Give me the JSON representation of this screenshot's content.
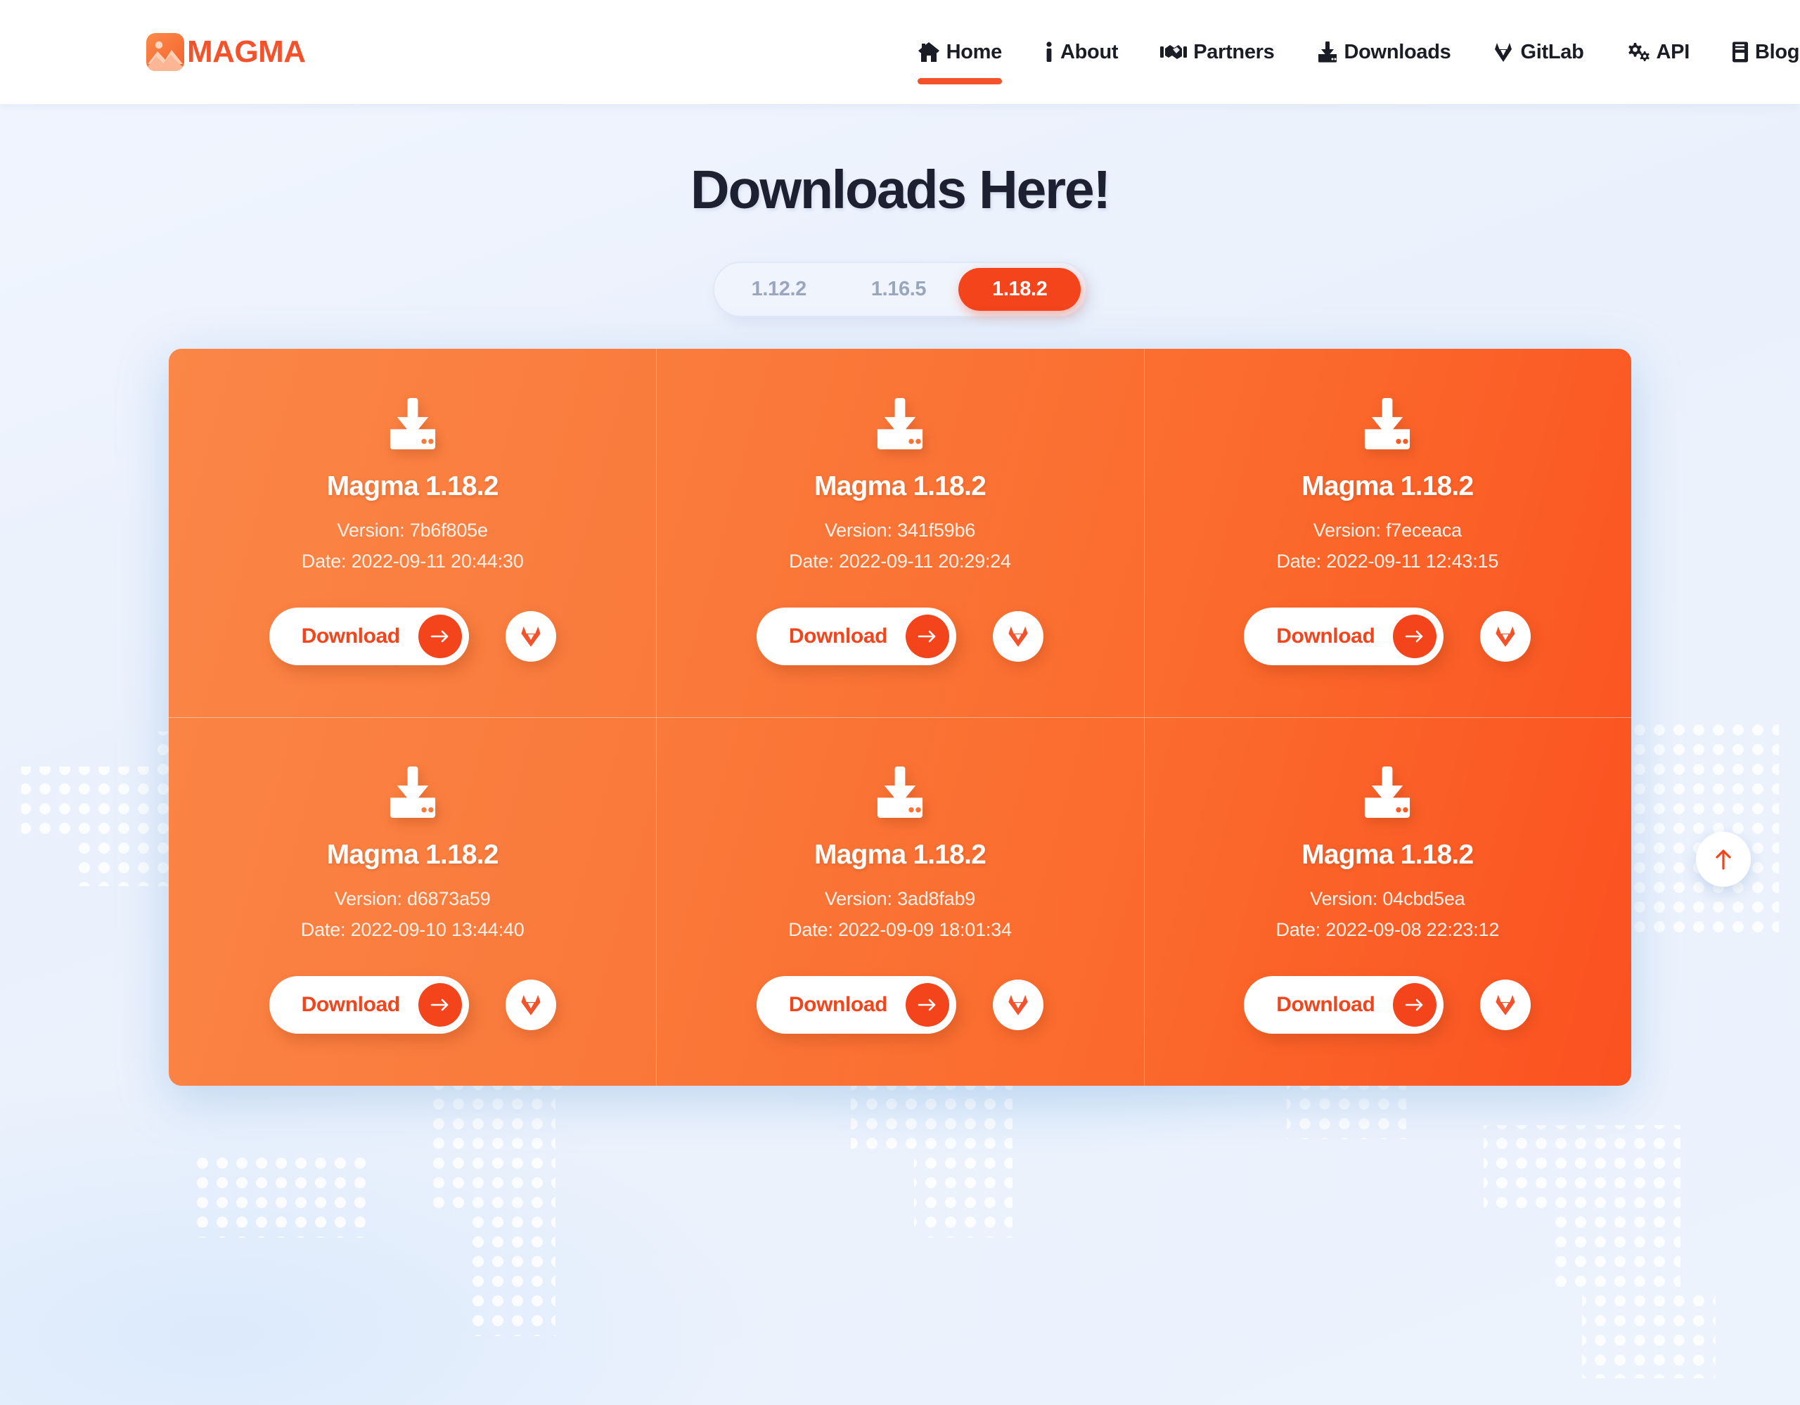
{
  "brand": {
    "name": "MAGMA",
    "icon": "image-photo-icon",
    "accent": "#f4522b"
  },
  "nav": {
    "items": [
      {
        "label": "Home",
        "icon": "home-icon",
        "active": true
      },
      {
        "label": "About",
        "icon": "info-icon",
        "active": false
      },
      {
        "label": "Partners",
        "icon": "handshake-icon",
        "active": false
      },
      {
        "label": "Downloads",
        "icon": "download-icon",
        "active": false
      },
      {
        "label": "GitLab",
        "icon": "gitlab-icon",
        "active": false
      },
      {
        "label": "API",
        "icon": "gears-icon",
        "active": false
      },
      {
        "label": "Blog",
        "icon": "book-icon",
        "active": false
      }
    ]
  },
  "page": {
    "title": "Downloads Here!"
  },
  "version_selector": {
    "options": [
      "1.12.2",
      "1.16.5",
      "1.18.2"
    ],
    "selected": "1.18.2",
    "active_color": "#f4441c",
    "inactive_color": "#9aa6bd"
  },
  "downloads": {
    "button_label": "Download",
    "button_icon": "arrow-right-icon",
    "repo_icon": "gitlab-fox-icon",
    "card_icon": "download-tray-icon",
    "cards": [
      {
        "title": "Magma 1.18.2",
        "version": "Version: 7b6f805e",
        "date": "Date: 2022-09-11 20:44:30"
      },
      {
        "title": "Magma 1.18.2",
        "version": "Version: 341f59b6",
        "date": "Date: 2022-09-11 20:29:24"
      },
      {
        "title": "Magma 1.18.2",
        "version": "Version: f7eceaca",
        "date": "Date: 2022-09-11 12:43:15"
      },
      {
        "title": "Magma 1.18.2",
        "version": "Version: d6873a59",
        "date": "Date: 2022-09-10 13:44:40"
      },
      {
        "title": "Magma 1.18.2",
        "version": "Version: 3ad8fab9",
        "date": "Date: 2022-09-09 18:01:34"
      },
      {
        "title": "Magma 1.18.2",
        "version": "Version: 04cbd5ea",
        "date": "Date: 2022-09-08 22:23:12"
      }
    ]
  },
  "scroll_top": {
    "icon": "arrow-up-icon"
  },
  "theme": {
    "page_bg": "#eef3fd",
    "card_gradient_from": "#fa8647",
    "card_gradient_to": "#fb5120",
    "title_color": "#1d2030"
  }
}
